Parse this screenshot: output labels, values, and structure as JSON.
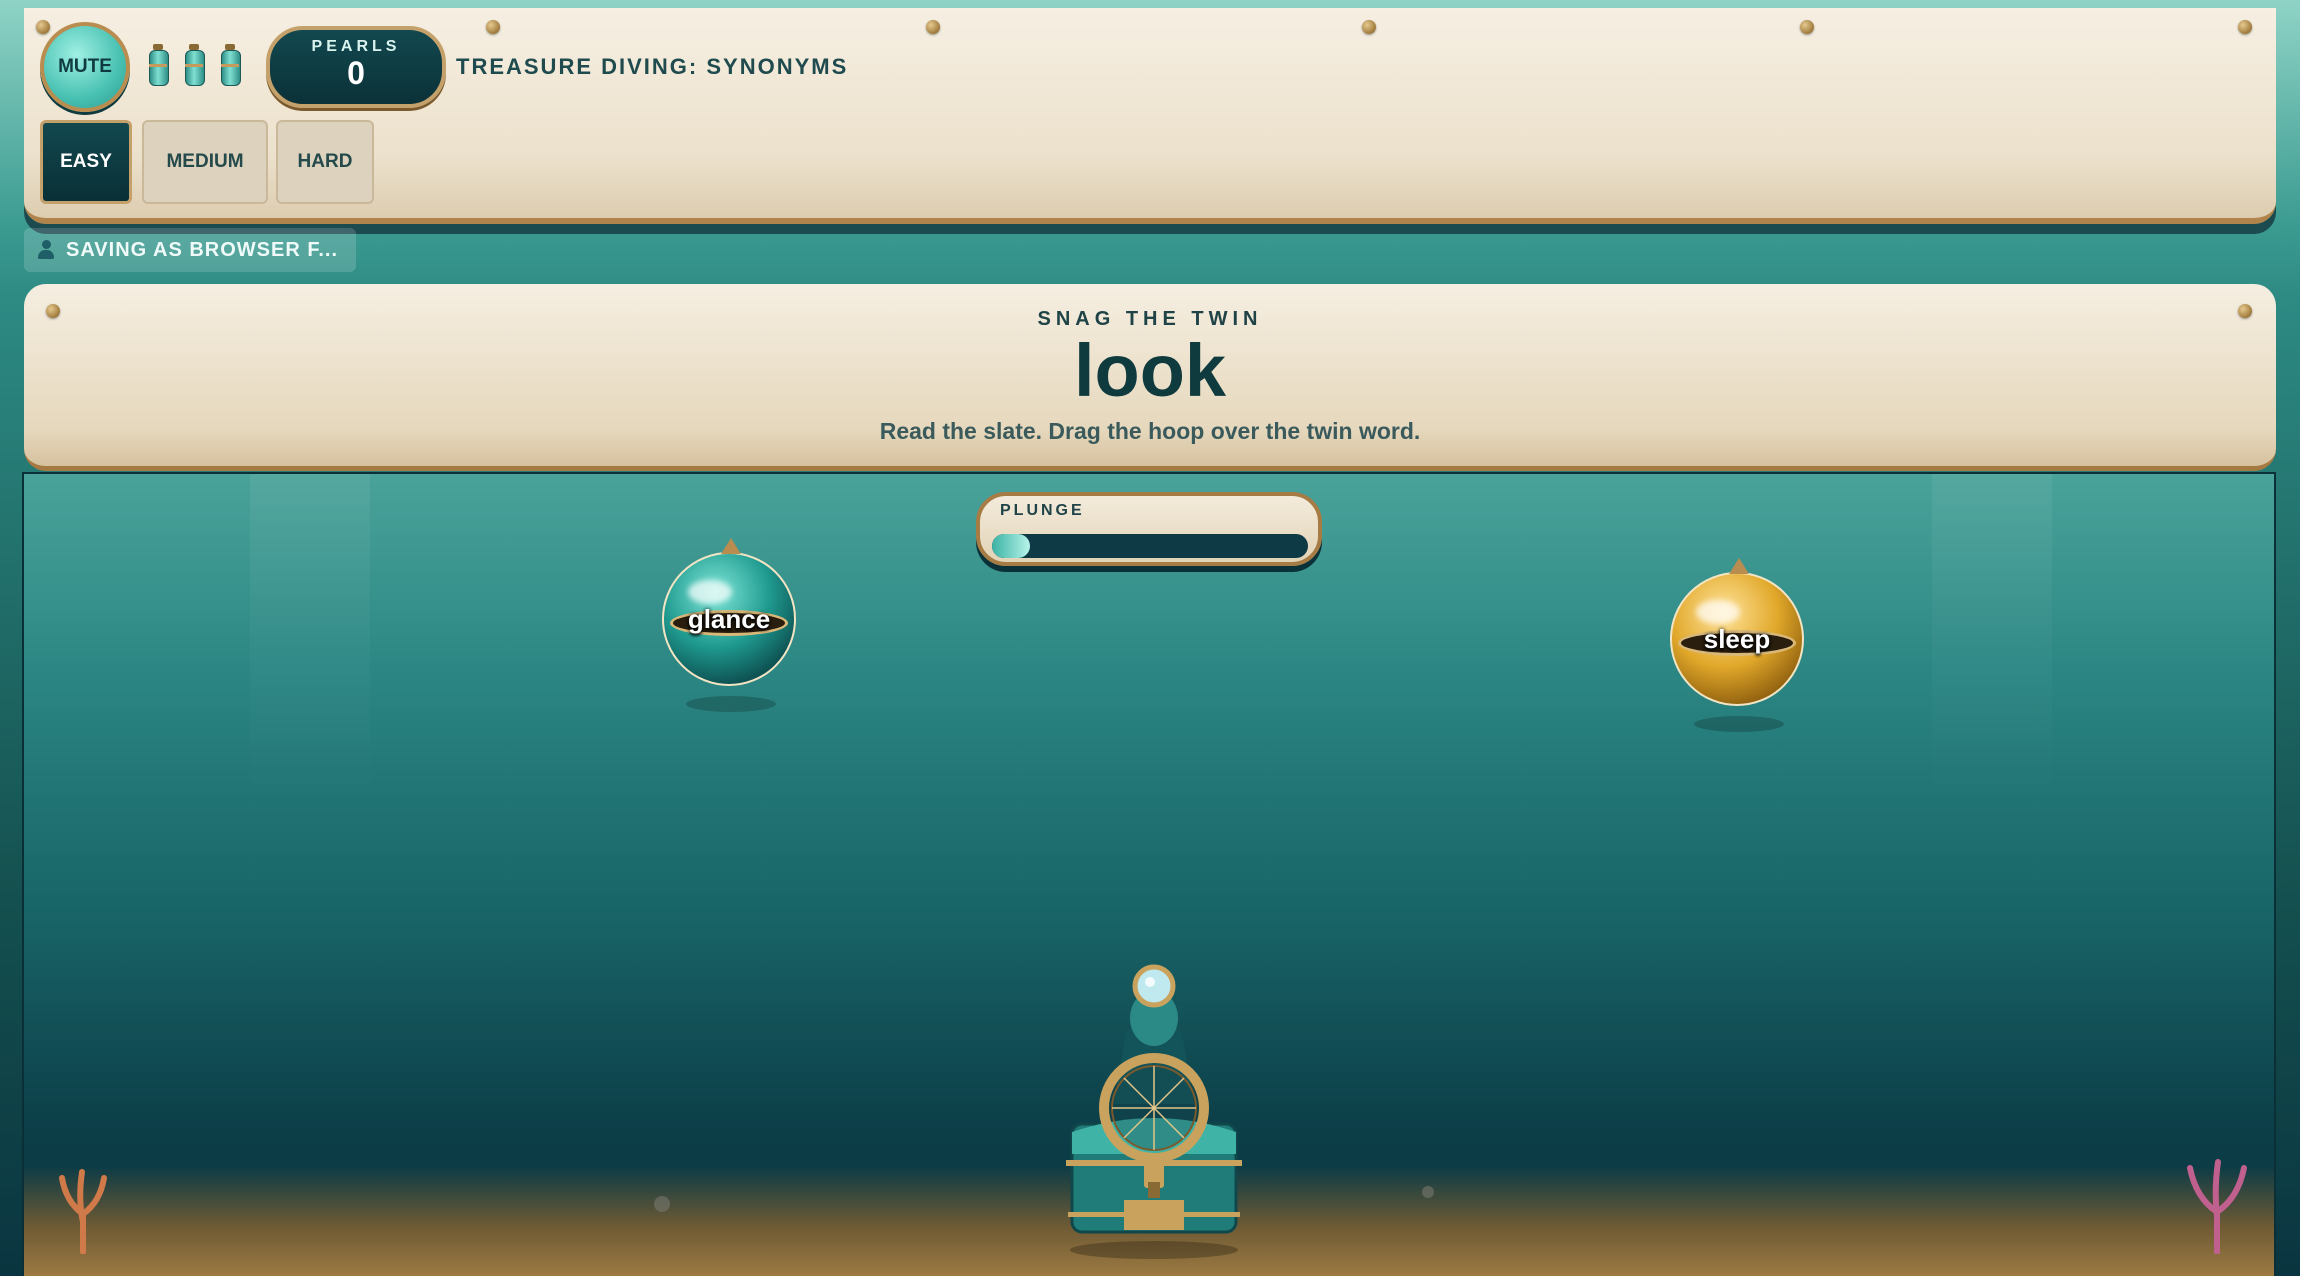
{
  "header": {
    "mute_label": "MUTE",
    "oxygen_tanks": 3,
    "pearls_label": "PEARLS",
    "pearls_value": "0",
    "title": "TREASURE DIVING: SYNONYMS",
    "difficulty": [
      {
        "label": "EASY",
        "active": true
      },
      {
        "label": "MEDIUM",
        "active": false
      },
      {
        "label": "HARD",
        "active": false
      }
    ]
  },
  "save_status": {
    "icon": "user-icon",
    "text": "SAVING AS BROWSER F..."
  },
  "prompt": {
    "kicker": "SNAG THE TWIN",
    "word": "look",
    "instructions": "Read the slate. Drag the hoop over the twin word."
  },
  "gauge": {
    "label": "PLUNGE",
    "progress": 0.12
  },
  "bubbles": [
    {
      "word": "glance",
      "color": "#1f9a8f"
    },
    {
      "word": "sleep",
      "color": "#e1a82a"
    }
  ],
  "colors": {
    "panel": "#f6efe2",
    "accent": "#c4a06a",
    "dark": "#0b3138",
    "water": "#186466"
  }
}
